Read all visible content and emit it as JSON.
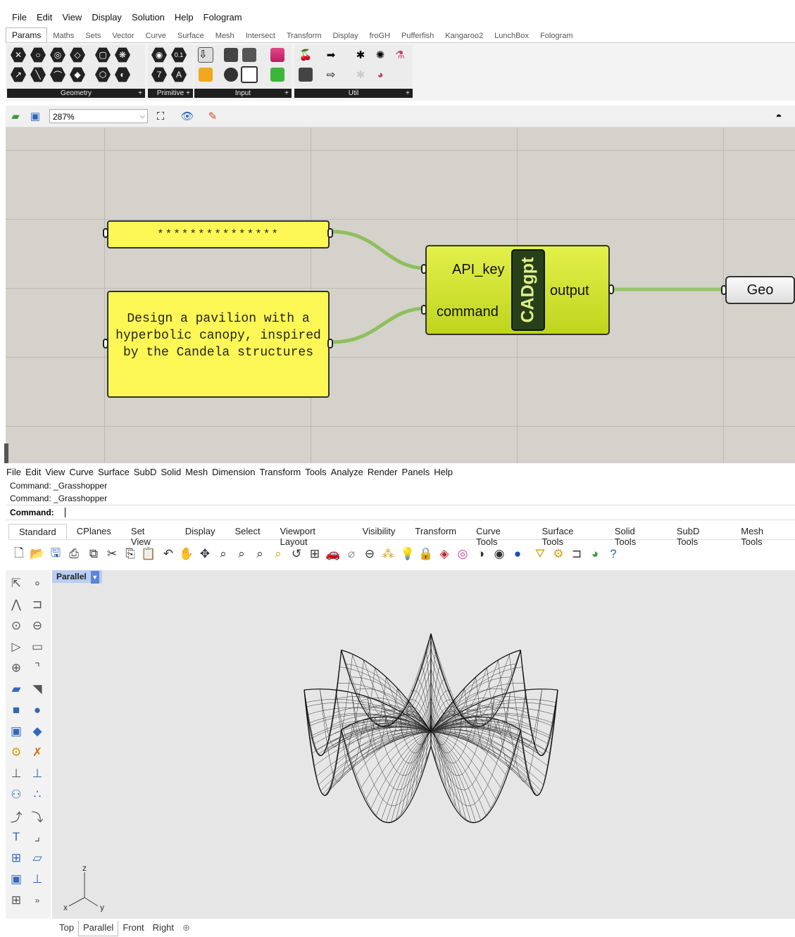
{
  "grasshopper": {
    "menu": [
      "File",
      "Edit",
      "View",
      "Display",
      "Solution",
      "Help",
      "Fologram"
    ],
    "tabs": [
      "Params",
      "Maths",
      "Sets",
      "Vector",
      "Curve",
      "Surface",
      "Mesh",
      "Intersect",
      "Transform",
      "Display",
      "froGH",
      "Pufferfish",
      "Kangaroo2",
      "LunchBox",
      "Fologram"
    ],
    "active_tab": "Params",
    "groups": [
      "Geometry",
      "Primitive",
      "Input",
      "Util"
    ],
    "zoom": "287%",
    "panel_api_key": "***************",
    "panel_command": "Design a pavilion with a hyperbolic canopy, inspired by the Candela structures",
    "component": {
      "name": "CADgpt",
      "inputs": [
        "API_key",
        "command"
      ],
      "output": "output"
    },
    "geo_param": "Geo",
    "colors": {
      "canvas": "#d4d2cb",
      "panel": "#fdf755",
      "component": "#c9dc2a",
      "wire": "#8fc35a"
    }
  },
  "rhino": {
    "menu": [
      "File",
      "Edit",
      "View",
      "Curve",
      "Surface",
      "SubD",
      "Solid",
      "Mesh",
      "Dimension",
      "Transform",
      "Tools",
      "Analyze",
      "Render",
      "Panels",
      "Help"
    ],
    "command_history": [
      "Command: _Grasshopper",
      "Command: _Grasshopper"
    ],
    "command_prompt": "Command:",
    "toolbar_tabs": [
      "Standard",
      "CPlanes",
      "Set View",
      "Display",
      "Select",
      "Viewport Layout",
      "Visibility",
      "Transform",
      "Curve Tools",
      "Surface Tools",
      "Solid Tools",
      "SubD Tools",
      "Mesh Tools"
    ],
    "active_toolbar_tab": "Standard",
    "viewport_title": "Parallel",
    "axes": {
      "z": "z",
      "x": "x",
      "y": "y"
    },
    "viewport_tabs": [
      "Top",
      "Parallel",
      "Front",
      "Right"
    ],
    "active_viewport_tab": "Parallel",
    "more_label": "»",
    "add_tab_icon": "⊕"
  }
}
